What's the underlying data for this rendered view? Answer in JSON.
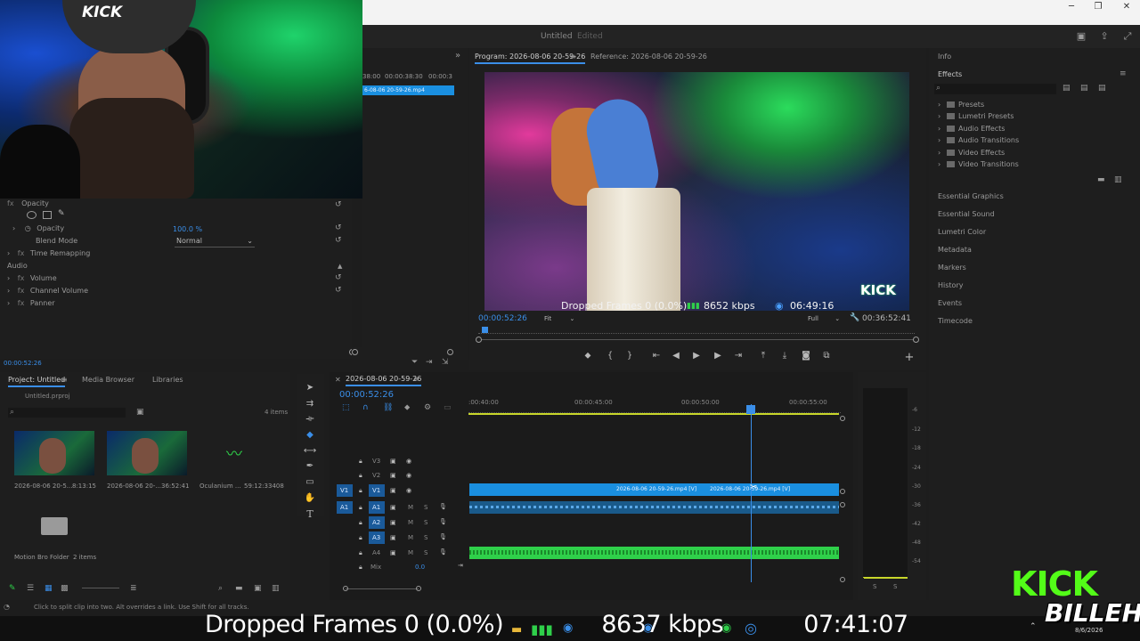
{
  "window": {
    "minimize": "─",
    "maximize": "❐",
    "close": "✕"
  },
  "header": {
    "document_title": "Untitled",
    "document_state": "Edited",
    "icons": [
      "quick-export-icon",
      "share-icon",
      "fullscreen-icon"
    ]
  },
  "source_panel": {
    "timecode_a": "38:00",
    "timecode_b": "00:00:38:30",
    "timecode_c": "00:00:3",
    "clip_name": "6-08-06 20-59-26.mp4"
  },
  "effect_controls": {
    "opacity_section": "Opacity",
    "opacity_label": "Opacity",
    "opacity_value": "100.0 %",
    "blend_mode_label": "Blend Mode",
    "blend_mode_value": "Normal",
    "time_remapping": "Time Remapping",
    "audio_section": "Audio",
    "volume": "Volume",
    "channel_volume": "Channel Volume",
    "panner": "Panner",
    "timecode": "00:00:52:26"
  },
  "program_monitor": {
    "tab_program": "Program: 2026-08-06 20-59-26",
    "tab_reference": "Reference: 2026-08-06 20-59-26",
    "current_time": "00:00:52:26",
    "fit": "Fit",
    "quality": "Full",
    "duration": "00:36:52:41",
    "overlay_dropped": "Dropped Frames 0 (0.0%)",
    "overlay_bitrate": "8652 kbps",
    "overlay_time": "06:49:16",
    "watermark": "KICK"
  },
  "right_panels": {
    "info": "Info",
    "effects": "Effects",
    "tree": [
      "Presets",
      "Lumetri Presets",
      "Audio Effects",
      "Audio Transitions",
      "Video Effects",
      "Video Transitions"
    ],
    "sections": [
      "Essential Graphics",
      "Essential Sound",
      "Lumetri Color",
      "Metadata",
      "Markers",
      "History",
      "Events",
      "Timecode"
    ]
  },
  "project_panel": {
    "tab_project": "Project: Untitled",
    "tab_media": "Media Browser",
    "tab_libraries": "Libraries",
    "file": "Untitled.prproj",
    "item_count": "4 items",
    "items": [
      {
        "name": "2026-08-06 20-5...",
        "duration": "8:13:15"
      },
      {
        "name": "2026-08-06 20-...",
        "duration": "36:52:41"
      },
      {
        "name": "Oculanium ...",
        "duration": "59:12:33408"
      }
    ],
    "folder_name": "Motion Bro Folder",
    "folder_count": "2 items"
  },
  "timeline": {
    "sequence_name": "2026-08-06 20-59-26",
    "timecode": "00:00:52:26",
    "ruler": [
      ":00:40:00",
      "00:00:45:00",
      "00:00:50:00",
      "00:00:55:00"
    ],
    "video_tracks": [
      "V3",
      "V2",
      "V1"
    ],
    "audio_tracks": [
      "A1",
      "A2",
      "A3",
      "A4"
    ],
    "source_v": "V1",
    "source_a": "A1",
    "mix_label": "Mix",
    "mix_value": "0.0",
    "clip_a": "2026-08-06 20-59-26.mp4 [V]",
    "clip_b": "2026-08-06 20-59-26.mp4 [V]",
    "m_label": "M",
    "s_label": "S"
  },
  "meters": {
    "scale": [
      "-6",
      "-12",
      "-18",
      "-24",
      "-30",
      "-36",
      "-42",
      "-48",
      "-54"
    ],
    "solo_l": "S",
    "solo_r": "S"
  },
  "status": {
    "message": "Click to split clip into two. Alt overrides a link. Use Shift for all tracks."
  },
  "overlay_bottom": {
    "dropped": "Dropped Frames 0 (0.0%)",
    "bitrate": "8637 kbps",
    "time": "07:41:07"
  },
  "kick_logo": {
    "line1": "KICK",
    "line2": "BILLEH"
  },
  "taskbar_clock": "8/6/2026",
  "colors": {
    "accent_blue": "#3a8ee8",
    "clip_video": "#1a8fe0",
    "clip_audio": "#2fd04a",
    "kick_green": "#53fc18"
  }
}
